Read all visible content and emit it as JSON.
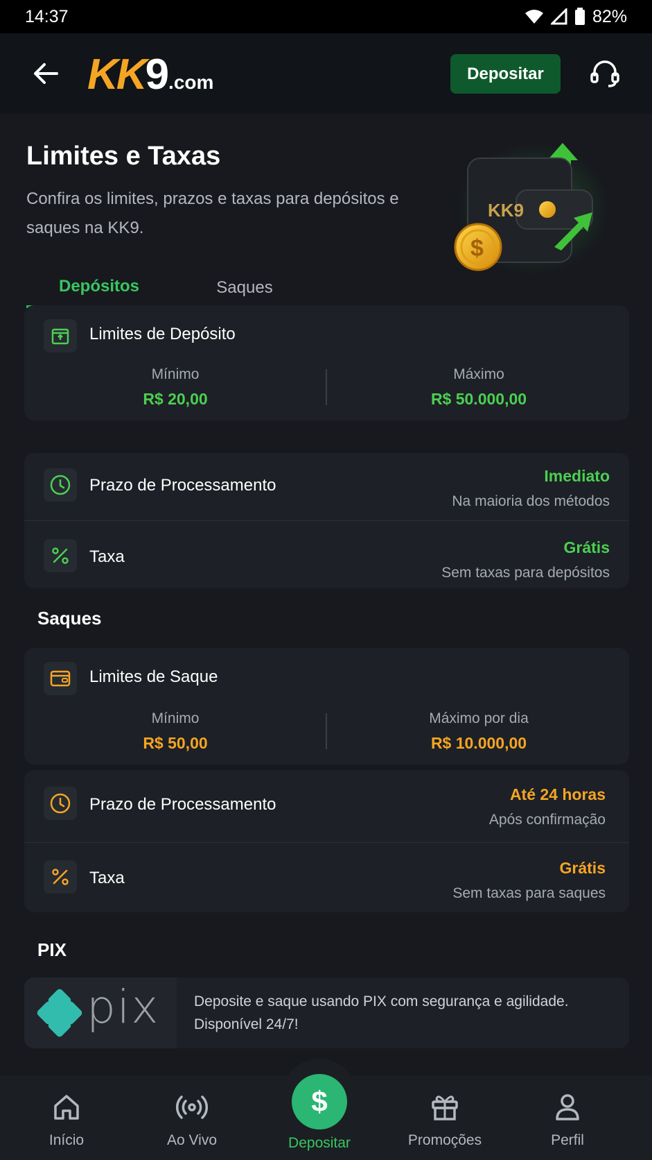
{
  "status_bar": {
    "time": "14:37",
    "battery": "82%"
  },
  "header": {
    "logo_main": "KK",
    "logo_digit": "9",
    "logo_suffix": ".com",
    "deposit_label": "Depositar"
  },
  "page": {
    "title": "Limites e Taxas",
    "subtitle": "Confira os limites, prazos e taxas para depósitos e saques na KK9.",
    "wallet_logo_text": "KK9"
  },
  "tabs": [
    {
      "label": "Depósitos",
      "active": true
    },
    {
      "label": "Saques",
      "active": false
    }
  ],
  "deposits": {
    "limits_title": "Limites de Depósito",
    "min_label": "Mínimo",
    "min_value": "R$ 20,00",
    "max_label": "Máximo",
    "max_value": "R$ 50.000,00",
    "processing_label": "Prazo de Processamento",
    "processing_value": "Imediato",
    "processing_sub": "Na maioria dos métodos",
    "fee_label": "Taxa",
    "fee_value": "Grátis",
    "fee_sub": "Sem taxas para depósitos"
  },
  "withdrawals": {
    "section_title": "Saques",
    "limits_title": "Limites de Saque",
    "min_label": "Mínimo",
    "min_value": "R$ 50,00",
    "max_label": "Máximo por dia",
    "max_value": "R$ 10.000,00",
    "processing_label": "Prazo de Processamento",
    "processing_value": "Até 24 horas",
    "processing_sub": "Após confirmação",
    "fee_label": "Taxa",
    "fee_value": "Grátis",
    "fee_sub": "Sem taxas para saques"
  },
  "pix": {
    "section_title": "PIX",
    "logo_text": "pix",
    "description": "Deposite e saque usando PIX com segurança e agilidade. Disponível 24/7!"
  },
  "bottom_nav": {
    "items": [
      {
        "label": "Início",
        "icon": "home-icon"
      },
      {
        "label": "Ao Vivo",
        "icon": "live-icon"
      },
      {
        "label": "Depositar",
        "icon": "dollar-icon"
      },
      {
        "label": "Promoções",
        "icon": "gift-icon"
      },
      {
        "label": "Perfil",
        "icon": "profile-icon"
      }
    ],
    "center_symbol": "$"
  },
  "colors": {
    "accent_green": "#4ccf52",
    "accent_orange": "#f5a524",
    "background": "#17191e",
    "card": "#1d2026",
    "deposit_button": "#0e5a2c"
  }
}
